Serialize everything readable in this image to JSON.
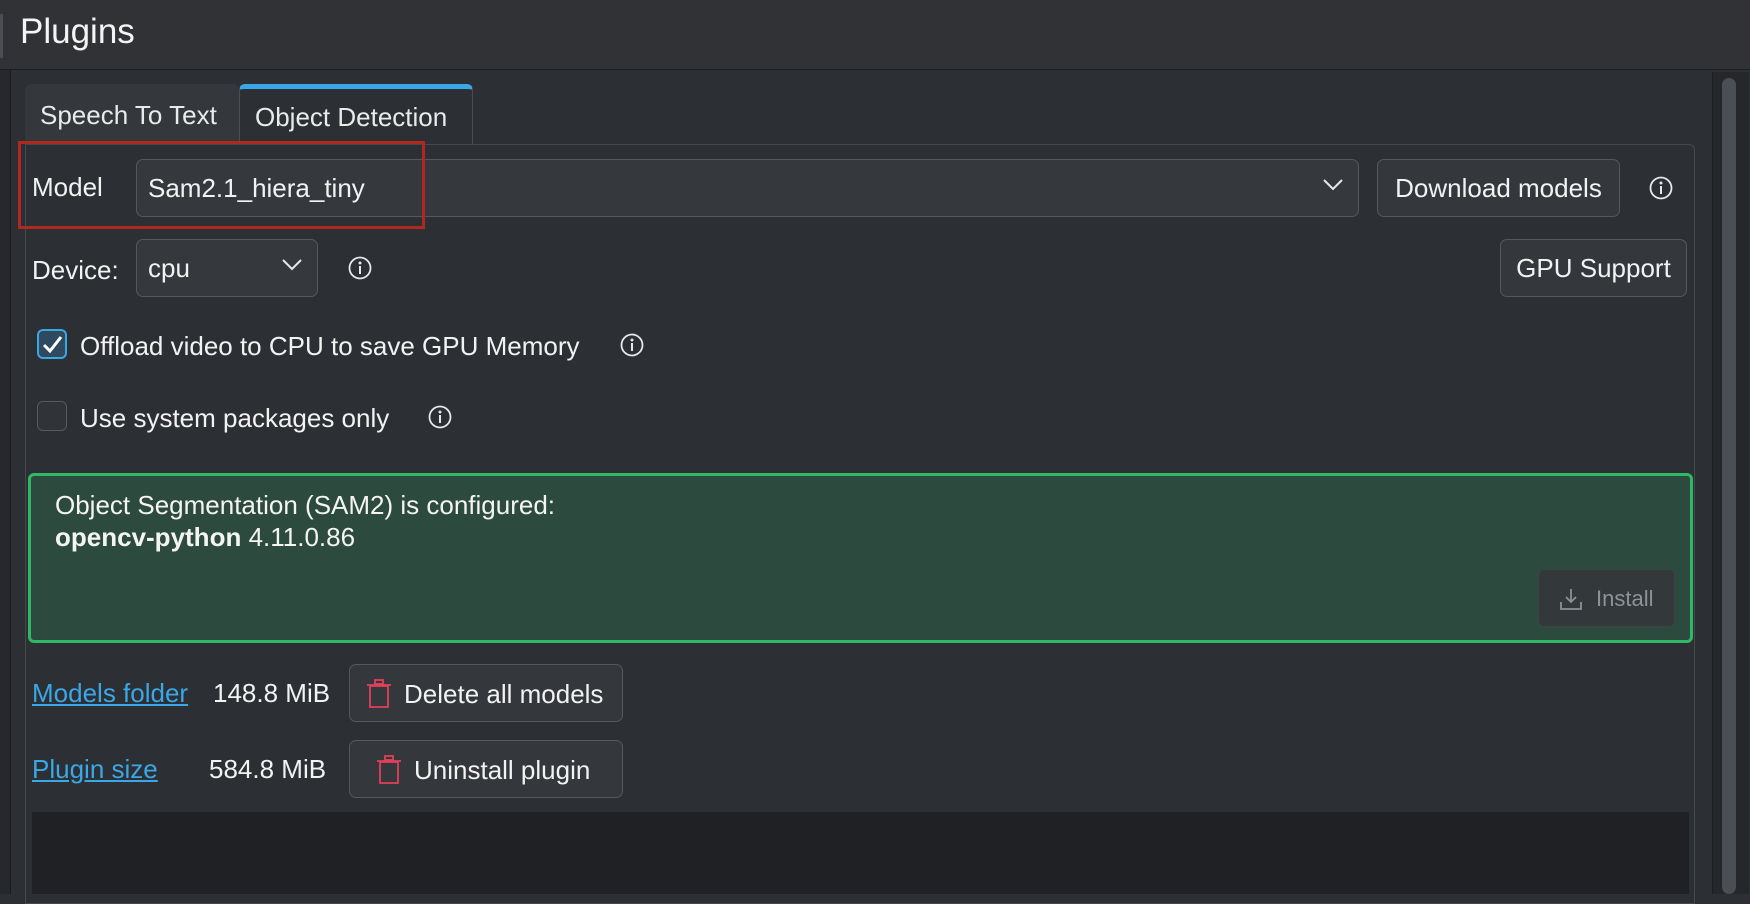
{
  "header": {
    "title": "Plugins"
  },
  "tabs": [
    {
      "label": "Speech To Text",
      "active": false
    },
    {
      "label": "Object Detection",
      "active": true
    }
  ],
  "model": {
    "label": "Model",
    "value": "Sam2.1_hiera_tiny",
    "download_label": "Download models"
  },
  "device": {
    "label": "Device:",
    "value": "cpu",
    "gpu_support_label": "GPU Support"
  },
  "options": {
    "offload_label": "Offload video to CPU to save GPU Memory",
    "offload_checked": true,
    "system_packages_label": "Use system packages only",
    "system_packages_checked": false
  },
  "status": {
    "line1": "Object Segmentation (SAM2) is configured:",
    "package_name": "opencv-python",
    "package_version": "4.11.0.86",
    "install_label": "Install"
  },
  "storage": {
    "models_folder_label": "Models folder",
    "models_folder_size": "148.8 MiB",
    "delete_label": "Delete all models",
    "plugin_size_label": "Plugin size",
    "plugin_size": "584.8 MiB",
    "uninstall_label": "Uninstall plugin"
  },
  "colors": {
    "accent": "#3aa7e6",
    "status_border": "#2fb865",
    "status_bg": "#2c4a3d",
    "highlight": "#b0281e",
    "danger_icon": "#e0405a"
  }
}
